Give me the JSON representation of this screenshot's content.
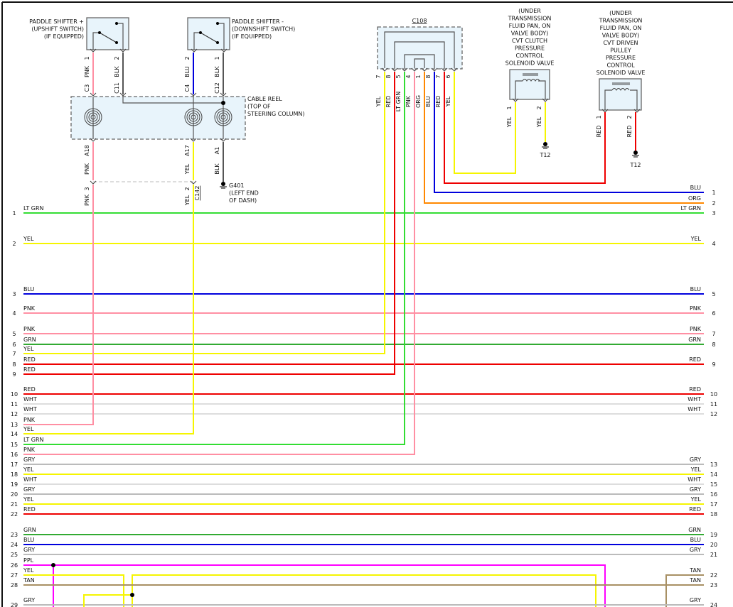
{
  "colors": {
    "LT GRN": "#33dd33",
    "GRN": "#33aa33",
    "YEL": "#f5f500",
    "RED": "#ee0000",
    "BLU": "#0000dd",
    "PNK": "#ff8fa3",
    "WHT": "#dddddd",
    "GRY": "#bbbbbb",
    "PPL": "#ff00ff",
    "TAN": "#a89064",
    "ORG": "#ff8800",
    "BLK": "#555555"
  },
  "components": {
    "upshift": {
      "label": [
        "PADDLE SHIFTER +",
        "(UPSHIFT SWITCH)",
        "(IF EQUIPPED)"
      ],
      "pins": [
        {
          "pin": "1",
          "wire": "PNK",
          "conn": "C3"
        },
        {
          "pin": "2",
          "wire": "BLK",
          "conn": "C11"
        }
      ]
    },
    "downshift": {
      "label": [
        "PADDLE SHIFTER -",
        "(DOWNSHIFT SWITCH)",
        "(IF EQUIPPED)"
      ],
      "pins": [
        {
          "pin": "2",
          "wire": "BLU",
          "conn": "C4"
        },
        {
          "pin": "1",
          "wire": "BLK",
          "conn": "C12"
        }
      ]
    },
    "cable_reel": {
      "label": [
        "CABLE REEL",
        "(TOP OF",
        "STEERING COLUMN)"
      ],
      "out_pins": [
        {
          "pin": "A18",
          "wire": "PNK"
        },
        {
          "pin": "A17",
          "wire": "YEL"
        },
        {
          "pin": "A1",
          "wire": "BLK"
        }
      ]
    },
    "c142": {
      "name": "C142",
      "pins": [
        {
          "pin": "3",
          "wire": "PNK"
        },
        {
          "pin": "2",
          "wire": "YEL"
        }
      ]
    },
    "g401": {
      "label": [
        "G401",
        "(LEFT END",
        "OF DASH)"
      ]
    },
    "c108": {
      "name": "C108",
      "pins": [
        {
          "pin": "7",
          "wire": "YEL"
        },
        {
          "pin": "8",
          "wire": "RED"
        },
        {
          "pin": "5",
          "wire": "LT GRN"
        },
        {
          "pin": "4",
          "wire": "PNK"
        },
        {
          "pin": "1",
          "wire": "ORG"
        },
        {
          "pin": "8",
          "wire": "BLU"
        },
        {
          "pin": "7",
          "wire": "RED"
        },
        {
          "pin": "6",
          "wire": "YEL"
        }
      ]
    },
    "sol1": {
      "label": [
        "(UNDER",
        "TRANSMISSION",
        "FLUID PAN, ON",
        "VALVE BODY)",
        "CVT CLUTCH",
        "PRESSURE",
        "CONTROL",
        "SOLENOID VALVE"
      ],
      "pins": [
        {
          "pin": "1",
          "wire": "YEL"
        },
        {
          "pin": "2",
          "wire": "YEL"
        }
      ],
      "ground": "T12"
    },
    "sol2": {
      "label": [
        "(UNDER",
        "TRANSMISSION",
        "FLUID PAN, ON",
        "VALVE BODY)",
        "CVT DRIVEN",
        "PULLEY",
        "PRESSURE",
        "CONTROL",
        "SOLENOID VALVE"
      ],
      "pins": [
        {
          "pin": "1",
          "wire": "RED"
        },
        {
          "pin": "2",
          "wire": "RED"
        }
      ],
      "ground": "T12"
    }
  },
  "wires": [
    {
      "lp": "",
      "lw": "",
      "rp": "1",
      "rw": "BLU"
    },
    {
      "lp": "",
      "lw": "",
      "rp": "2",
      "rw": "ORG"
    },
    {
      "lp": "1",
      "lw": "LT GRN",
      "rp": "3",
      "rw": "LT GRN"
    },
    {
      "lp": "2",
      "lw": "YEL",
      "rp": "4",
      "rw": "YEL"
    },
    {
      "lp": "3",
      "lw": "BLU",
      "rp": "5",
      "rw": "BLU"
    },
    {
      "lp": "4",
      "lw": "PNK",
      "rp": "6",
      "rw": "PNK"
    },
    {
      "lp": "5",
      "lw": "PNK",
      "rp": "7",
      "rw": "PNK"
    },
    {
      "lp": "6",
      "lw": "GRN",
      "rp": "8",
      "rw": "GRN"
    },
    {
      "lp": "7",
      "lw": "YEL",
      "rp": "",
      "rw": ""
    },
    {
      "lp": "8",
      "lw": "RED",
      "rp": "9",
      "rw": "RED"
    },
    {
      "lp": "9",
      "lw": "RED",
      "rp": "",
      "rw": ""
    },
    {
      "lp": "10",
      "lw": "RED",
      "rp": "10",
      "rw": "RED"
    },
    {
      "lp": "11",
      "lw": "WHT",
      "rp": "11",
      "rw": "WHT"
    },
    {
      "lp": "12",
      "lw": "WHT",
      "rp": "12",
      "rw": "WHT"
    },
    {
      "lp": "13",
      "lw": "PNK",
      "rp": "",
      "rw": ""
    },
    {
      "lp": "14",
      "lw": "YEL",
      "rp": "",
      "rw": ""
    },
    {
      "lp": "15",
      "lw": "LT GRN",
      "rp": "",
      "rw": ""
    },
    {
      "lp": "16",
      "lw": "PNK",
      "rp": "",
      "rw": ""
    },
    {
      "lp": "17",
      "lw": "GRY",
      "rp": "13",
      "rw": "GRY"
    },
    {
      "lp": "18",
      "lw": "YEL",
      "rp": "14",
      "rw": "YEL"
    },
    {
      "lp": "19",
      "lw": "WHT",
      "rp": "15",
      "rw": "WHT"
    },
    {
      "lp": "20",
      "lw": "GRY",
      "rp": "16",
      "rw": "GRY"
    },
    {
      "lp": "21",
      "lw": "YEL",
      "rp": "17",
      "rw": "YEL"
    },
    {
      "lp": "22",
      "lw": "RED",
      "rp": "18",
      "rw": "RED"
    },
    {
      "lp": "23",
      "lw": "GRN",
      "rp": "19",
      "rw": "GRN"
    },
    {
      "lp": "24",
      "lw": "BLU",
      "rp": "20",
      "rw": "BLU"
    },
    {
      "lp": "25",
      "lw": "GRY",
      "rp": "21",
      "rw": "GRY"
    },
    {
      "lp": "26",
      "lw": "PPL",
      "rp": "",
      "rw": ""
    },
    {
      "lp": "27",
      "lw": "YEL",
      "rp": "22",
      "rw": "TAN"
    },
    {
      "lp": "28",
      "lw": "TAN",
      "rp": "23",
      "rw": "TAN"
    },
    {
      "lp": "29",
      "lw": "GRY",
      "rp": "24",
      "rw": "GRY"
    }
  ]
}
